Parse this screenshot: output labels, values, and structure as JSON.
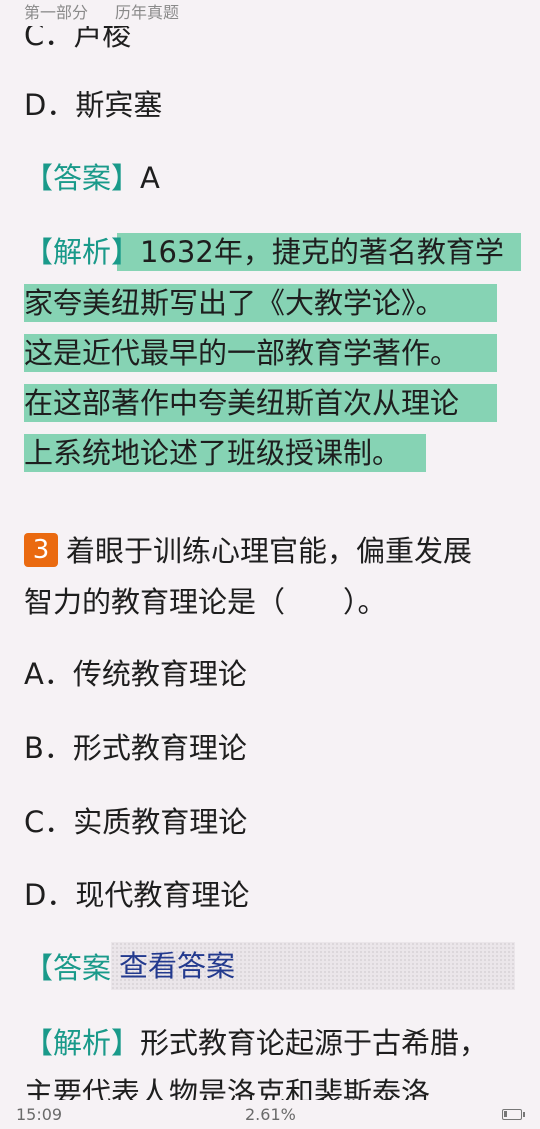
{
  "header": {
    "section": "第一部分",
    "chapter": "历年真题"
  },
  "prev_question": {
    "option_c_partial": "C．卢梭",
    "option_d": "D．斯宾塞",
    "answer_bracket": "【答案】",
    "answer_value": "A",
    "analysis_bracket": "【解析】",
    "analysis_lines": [
      "1632年，捷克的著名教育学",
      "家夸美纽斯写出了《大教学论》。",
      "这是近代最早的一部教育学著作。",
      "在这部著作中夸美纽斯首次从理论",
      "上系统地论述了班级授课制。"
    ]
  },
  "question": {
    "number": "3",
    "stem_line1": "着眼于训练心理官能，偏重发展",
    "stem_line2": "智力的教育理论是（　　）。",
    "options": [
      "A．传统教育理论",
      "B．形式教育理论",
      "C．实质教育理论",
      "D．现代教育理论"
    ],
    "answer_bracket": "【答案】",
    "reveal_label": "查看答案",
    "analysis_bracket": "【解析】",
    "analysis_line1": "形式教育论起源于古希腊，",
    "analysis_line2_partial": "主要代表人物是洛克和裴斯泰洛"
  },
  "status": {
    "time": "15:09",
    "progress": "2.61%"
  },
  "colors": {
    "highlight": "#86d3b4",
    "bracket": "#1a9a8a",
    "question_badge": "#ea6a10",
    "reveal_text": "#233a8e"
  }
}
